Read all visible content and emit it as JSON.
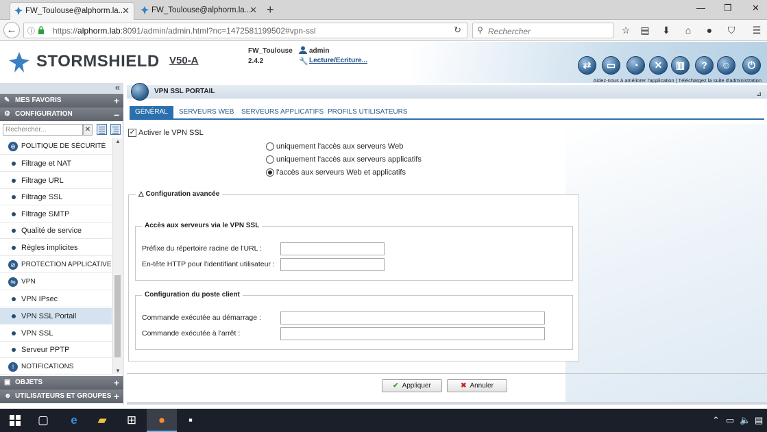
{
  "browser": {
    "tabs": [
      {
        "title": "FW_Toulouse@alphorm.la...",
        "active": true
      },
      {
        "title": "FW_Toulouse@alphorm.la...",
        "active": false
      }
    ],
    "close_glyph": "✕",
    "new_tab_glyph": "+",
    "window_controls": {
      "minimize": "—",
      "maximize": "❐",
      "close": "✕"
    },
    "url_prefix": "https://",
    "url_host": "alphorm.lab",
    "url_rest": ":8091/admin/admin.html?nc=1472581199502#vpn-ssl",
    "search_placeholder": "Rechercher"
  },
  "header": {
    "brand": "STORMSHIELD",
    "model": "V50-A",
    "firewall_name": "FW_Toulouse",
    "firmware_version": "2.4.2",
    "user": "admin",
    "access_mode": "Lecture/Ecriture...",
    "help_links": "Aidez-nous à améliorer l'application | Téléchargez la suite d'administration",
    "accent_color": "#2c5d8d"
  },
  "sidebar": {
    "favorites": "MES FAVORIS",
    "configuration": "CONFIGURATION",
    "search_placeholder": "Rechercher...",
    "search_clear": "✕",
    "items": [
      {
        "label": "POLITIQUE DE SÉCURITÉ",
        "type": "group",
        "icon": "shield-icon"
      },
      {
        "label": "Filtrage et NAT",
        "type": "leaf"
      },
      {
        "label": "Filtrage URL",
        "type": "leaf"
      },
      {
        "label": "Filtrage SSL",
        "type": "leaf"
      },
      {
        "label": "Filtrage SMTP",
        "type": "leaf"
      },
      {
        "label": "Qualité de service",
        "type": "leaf"
      },
      {
        "label": "Règles implicites",
        "type": "leaf"
      },
      {
        "label": "PROTECTION APPLICATIVE",
        "type": "group",
        "icon": "protection-icon"
      },
      {
        "label": "VPN",
        "type": "group",
        "icon": "vpn-icon"
      },
      {
        "label": "VPN IPsec",
        "type": "leaf"
      },
      {
        "label": "VPN SSL Portail",
        "type": "leaf",
        "selected": true
      },
      {
        "label": "VPN SSL",
        "type": "leaf"
      },
      {
        "label": "Serveur PPTP",
        "type": "leaf"
      },
      {
        "label": "NOTIFICATIONS",
        "type": "group",
        "icon": "notifications-icon"
      }
    ],
    "objects": "OBJETS",
    "users_groups": "UTILISATEURS ET GROUPES"
  },
  "page": {
    "title": "VPN SSL PORTAIL",
    "tabs": [
      "GÉNÉRAL",
      "SERVEURS WEB",
      "SERVEURS APPLICATIFS",
      "PROFILS UTILISATEURS"
    ],
    "active_tab": "GÉNÉRAL",
    "enable_vpn_ssl": "Activer le VPN SSL",
    "enable_checked": true,
    "check_glyph": "✓",
    "access_options": [
      "uniquement l'accès aux serveurs Web",
      "uniquement l'accès aux serveurs applicatifs",
      "l'accès aux serveurs Web et applicatifs"
    ],
    "selected_option": 2,
    "advanced_title": "Configuration avancée",
    "access_section_title": "Accès aux serveurs via le VPN SSL",
    "url_prefix_label": "Préfixe du répertoire racine de l'URL :",
    "url_prefix_value": "",
    "http_header_label": "En-tête HTTP pour l'identifiant utilisateur :",
    "http_header_value": "",
    "client_section_title": "Configuration du poste client",
    "start_cmd_label": "Commande exécutée au démarrage :",
    "start_cmd_value": "",
    "stop_cmd_label": "Commande exécutée à l'arrêt :",
    "stop_cmd_value": "",
    "apply_label": "Appliquer",
    "cancel_label": "Annuler"
  }
}
